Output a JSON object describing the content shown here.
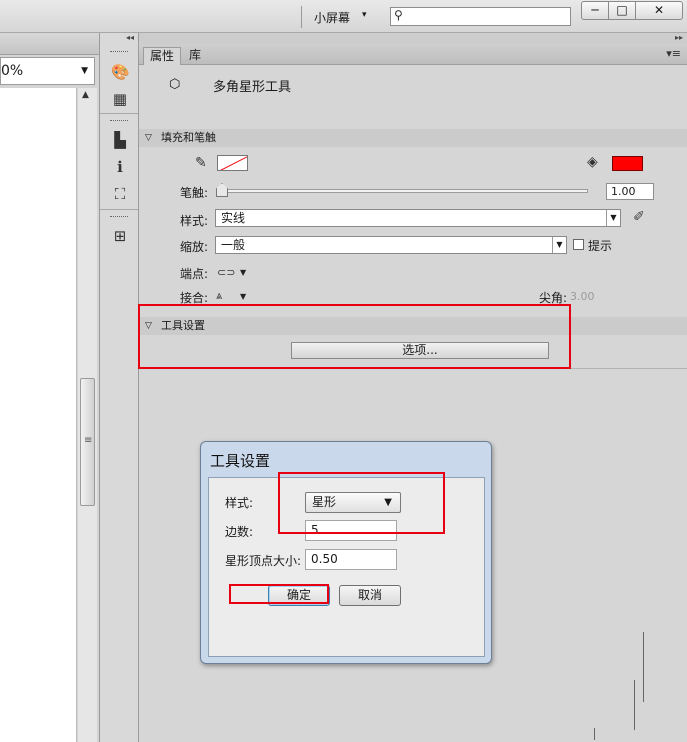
{
  "topbar": {
    "workspace_label": "小屏幕",
    "search_placeholder": "",
    "min_glyph": "─",
    "max_glyph": "□",
    "close_glyph": "✕"
  },
  "document": {
    "zoom_value": "0%"
  },
  "panel": {
    "tabs": [
      {
        "label": "属性"
      },
      {
        "label": "库"
      }
    ],
    "tool_name": "多角星形工具",
    "fill_stroke_section": "填充和笔触",
    "stroke_label": "笔触:",
    "stroke_value": "1.00",
    "style_label": "样式:",
    "style_value": "实线",
    "scale_label": "缩放:",
    "scale_value": "一般",
    "hint_label": "提示",
    "cap_label": "端点:",
    "join_label": "接合:",
    "miter_label": "尖角:",
    "miter_value": "3.00",
    "tool_settings_section": "工具设置",
    "options_button": "选项...",
    "colors": {
      "stroke": "#ff0000",
      "fill": "#ff0000"
    }
  },
  "dialog": {
    "title": "工具设置",
    "style_label": "样式:",
    "style_value": "星形",
    "sides_label": "边数:",
    "sides_value": "5",
    "point_size_label": "星形顶点大小:",
    "point_size_value": "0.50",
    "ok_button": "确定",
    "cancel_button": "取消"
  },
  "annotation_color": "#e60012"
}
